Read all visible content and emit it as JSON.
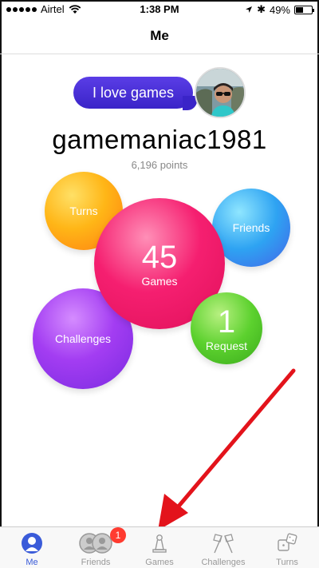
{
  "status_bar": {
    "carrier": "Airtel",
    "time": "1:38 PM",
    "battery_percent": "49%",
    "battery_level": 0.49
  },
  "nav": {
    "title": "Me"
  },
  "profile": {
    "status_message": "I love games",
    "username": "gamemaniac1981",
    "points": "6,196 points"
  },
  "bubbles": {
    "turns": {
      "label": "Turns"
    },
    "friends": {
      "label": "Friends"
    },
    "games": {
      "count": "45",
      "label": "Games"
    },
    "challenges": {
      "label": "Challenges"
    },
    "request": {
      "count": "1",
      "label": "Request"
    }
  },
  "tabs": [
    {
      "label": "Me",
      "icon": "person-icon",
      "active": true
    },
    {
      "label": "Friends",
      "icon": "friends-icon",
      "badge": "1"
    },
    {
      "label": "Games",
      "icon": "pawn-icon"
    },
    {
      "label": "Challenges",
      "icon": "flags-icon"
    },
    {
      "label": "Turns",
      "icon": "dice-icon"
    }
  ],
  "colors": {
    "accent": "#3a5bd9",
    "arrow": "#e3131b",
    "badge": "#ff3b30"
  }
}
